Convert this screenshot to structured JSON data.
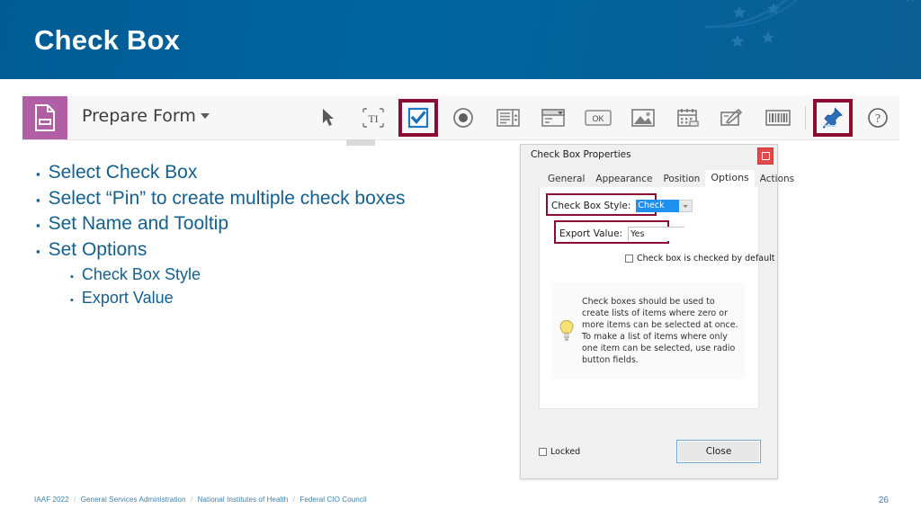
{
  "slide": {
    "title": "Check Box",
    "page_number": "26",
    "header_color": "#00609a",
    "accent_text_color": "#14608d",
    "highlight_color": "#8c0b30"
  },
  "toolbar": {
    "mode_icon": "prepare-form-document-icon",
    "mode_label": "Prepare Form",
    "dropdown_caret": "chevron-down-icon",
    "tools": [
      {
        "name": "select-cursor-icon",
        "label": "Select",
        "highlighted": false
      },
      {
        "name": "text-field-icon",
        "label": "Text Field",
        "highlighted": false
      },
      {
        "name": "check-box-icon",
        "label": "Check Box",
        "highlighted": true
      },
      {
        "name": "radio-button-icon",
        "label": "Radio Button",
        "highlighted": false
      },
      {
        "name": "list-box-icon",
        "label": "List Box",
        "highlighted": false
      },
      {
        "name": "dropdown-icon",
        "label": "Dropdown",
        "highlighted": false
      },
      {
        "name": "ok-button-icon",
        "label": "Button",
        "highlighted": false
      },
      {
        "name": "image-field-icon",
        "label": "Image Field",
        "highlighted": false
      },
      {
        "name": "date-field-icon",
        "label": "Date Field",
        "highlighted": false
      },
      {
        "name": "signature-field-icon",
        "label": "Signature",
        "highlighted": false
      },
      {
        "name": "barcode-icon",
        "label": "Barcode",
        "highlighted": false
      },
      {
        "name": "pin-icon",
        "label": "Keep Tool Selected",
        "highlighted": true
      },
      {
        "name": "help-icon",
        "label": "Help",
        "highlighted": false
      }
    ]
  },
  "bullets": [
    {
      "level": 1,
      "text": "Select Check Box"
    },
    {
      "level": 1,
      "text": "Select “Pin” to create multiple check boxes"
    },
    {
      "level": 1,
      "text": "Set Name and Tooltip"
    },
    {
      "level": 1,
      "text": "Set Options"
    },
    {
      "level": 2,
      "text": "Check Box Style"
    },
    {
      "level": 2,
      "text": "Export Value"
    }
  ],
  "bullet_mark": "▪",
  "dialog": {
    "title": "Check Box Properties",
    "close_icon": "close-icon",
    "tabs": [
      {
        "label": "General",
        "active": false
      },
      {
        "label": "Appearance",
        "active": false
      },
      {
        "label": "Position",
        "active": false
      },
      {
        "label": "Options",
        "active": true
      },
      {
        "label": "Actions",
        "active": false
      }
    ],
    "style_field": {
      "label": "Check Box Style:",
      "value": "Check",
      "arrow_icon": "chevron-down-icon"
    },
    "export_field": {
      "label": "Export Value:",
      "value": "Yes"
    },
    "default_checkbox": {
      "label": "Check box is checked by default",
      "checked": false
    },
    "tip": {
      "icon": "lightbulb-icon",
      "text": "Check boxes should be used to create lists of items where zero or more items can be selected at once. To make a list of items where only one item can be selected, use radio button fields."
    },
    "locked_checkbox": {
      "label": "Locked",
      "checked": false
    },
    "close_button": "Close"
  },
  "footer": {
    "parts": [
      "IAAF 2022",
      "General Services Administration",
      "National Institutes of Health",
      "Federal CIO Council"
    ],
    "separator": "/"
  }
}
